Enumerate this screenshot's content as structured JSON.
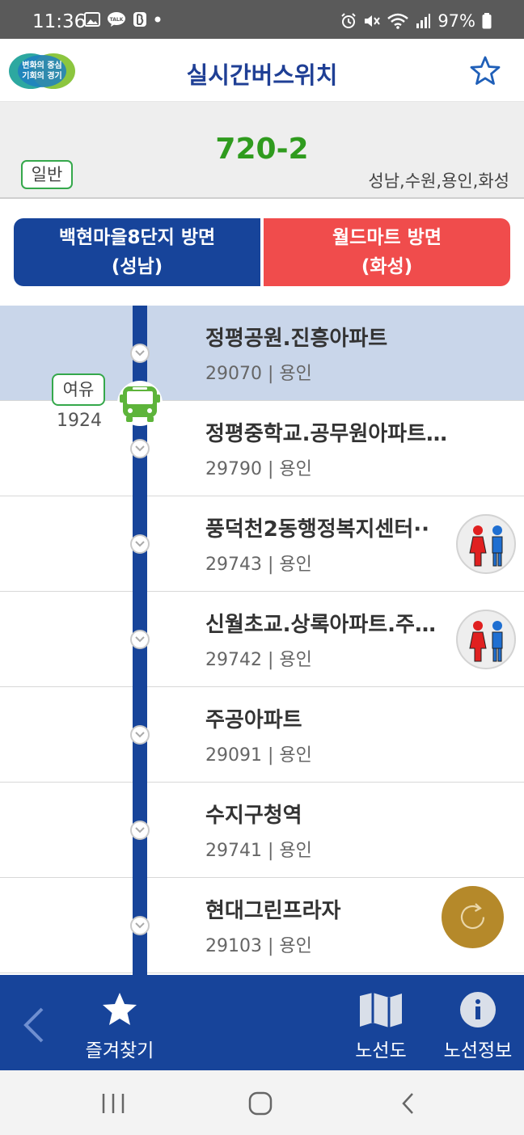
{
  "status_bar": {
    "time": "11:36",
    "battery": "97%",
    "left_icons": [
      "gallery-icon",
      "talk-icon",
      "b-icon",
      "dot-icon"
    ],
    "right_icons": [
      "alarm-icon",
      "mute-icon",
      "wifi-icon",
      "signal-icon",
      "battery-icon"
    ]
  },
  "header": {
    "logo_text_line1": "변화의 중심",
    "logo_text_line2": "기회의 경기",
    "title": "실시간버스위치"
  },
  "route": {
    "number": "720-2",
    "type": "일반",
    "region": "성남,수원,용인,화성"
  },
  "directions": [
    {
      "line1": "백현마을8단지 방면",
      "line2": "(성남)"
    },
    {
      "line1": "월드마트 방면",
      "line2": "(화성)"
    }
  ],
  "bus": {
    "seat_status": "여유",
    "bus_id": "1924"
  },
  "stops": [
    {
      "name": "정평공원.진흥아파트",
      "meta": "29070 | 용인"
    },
    {
      "name": "정평중학교.공무원아파트.상…",
      "meta": "29790 | 용인"
    },
    {
      "name": "풍덕천2동행정복지센터··",
      "meta": "29743 | 용인"
    },
    {
      "name": "신월초교.상록아파트.주…",
      "meta": "29742 | 용인"
    },
    {
      "name": "주공아파트",
      "meta": "29091 | 용인"
    },
    {
      "name": "수지구청역",
      "meta": "29741 | 용인"
    },
    {
      "name": "현대그린프라자",
      "meta": "29103 | 용인"
    }
  ],
  "bottom_nav": {
    "favorites": "즐겨찾기",
    "route_map": "노선도",
    "route_info": "노선정보"
  },
  "colors": {
    "primary_blue": "#17449a",
    "title_blue": "#1f3f95",
    "route_green": "#2f9b1e",
    "direction_red": "#f04c4c",
    "active_row": "#c9d6ea",
    "refresh_gold": "#b5892a",
    "bus_green": "#5db43a"
  }
}
